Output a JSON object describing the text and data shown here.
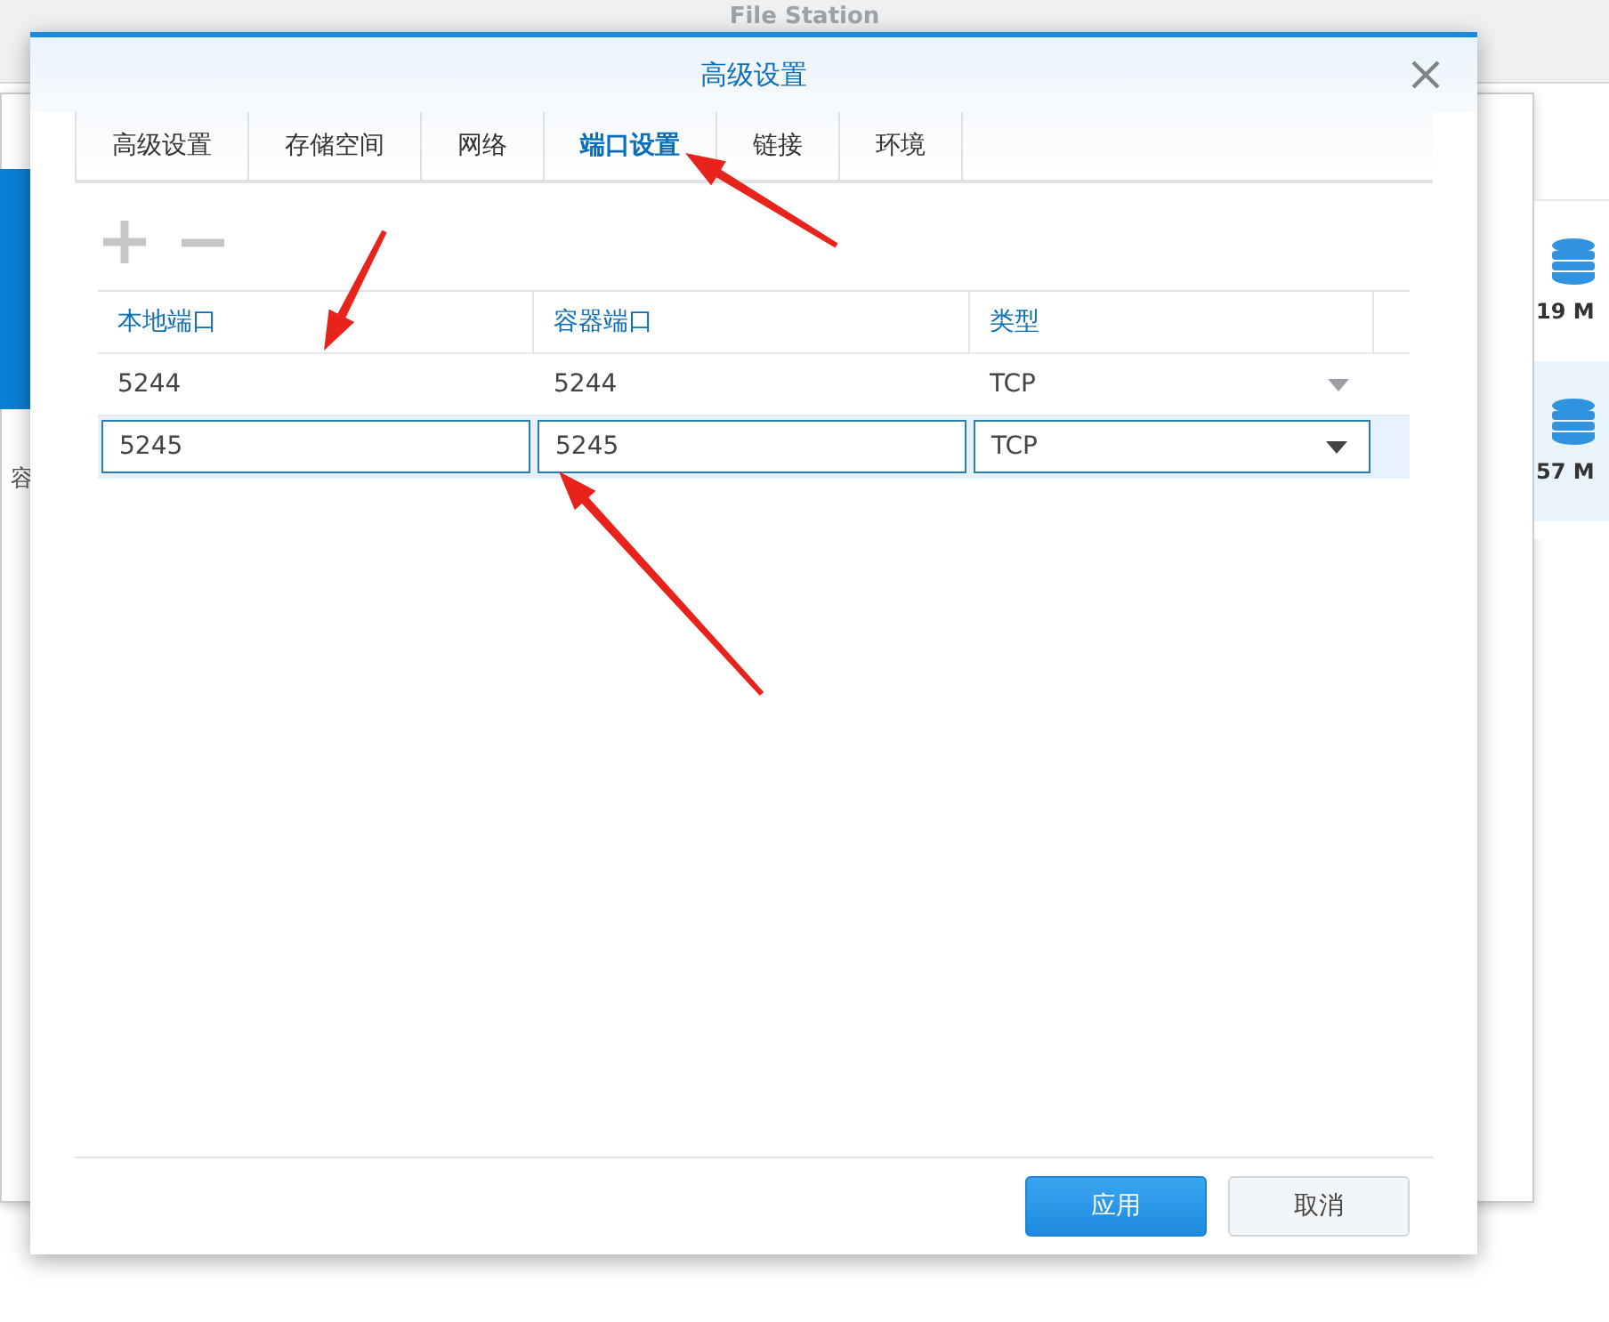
{
  "background": {
    "app_title": "File Station",
    "left_window": {
      "label": "容"
    },
    "right_panel": {
      "items": [
        {
          "size": "19 M",
          "selected": false
        },
        {
          "size": "57 M",
          "selected": true
        }
      ]
    }
  },
  "dialog": {
    "title": "高级设置",
    "tabs": [
      {
        "label": "高级设置",
        "selected": false
      },
      {
        "label": "存储空间",
        "selected": false
      },
      {
        "label": "网络",
        "selected": false
      },
      {
        "label": "端口设置",
        "selected": true
      },
      {
        "label": "链接",
        "selected": false
      },
      {
        "label": "环境",
        "selected": false
      }
    ],
    "toolbar": [
      {
        "kind": "add",
        "disabled": true
      },
      {
        "kind": "remove",
        "disabled": true
      }
    ],
    "table": {
      "columns": [
        "本地端口",
        "容器端口",
        "类型"
      ],
      "rows": [
        {
          "cells": [
            "5244",
            "5244",
            "TCP"
          ],
          "selected": false
        },
        {
          "cells": [
            "5245",
            "5245",
            "TCP"
          ],
          "selected": true
        }
      ]
    },
    "buttons": [
      {
        "label": "应用",
        "kind": "primary"
      },
      {
        "label": "取消",
        "kind": "secondary"
      }
    ]
  }
}
